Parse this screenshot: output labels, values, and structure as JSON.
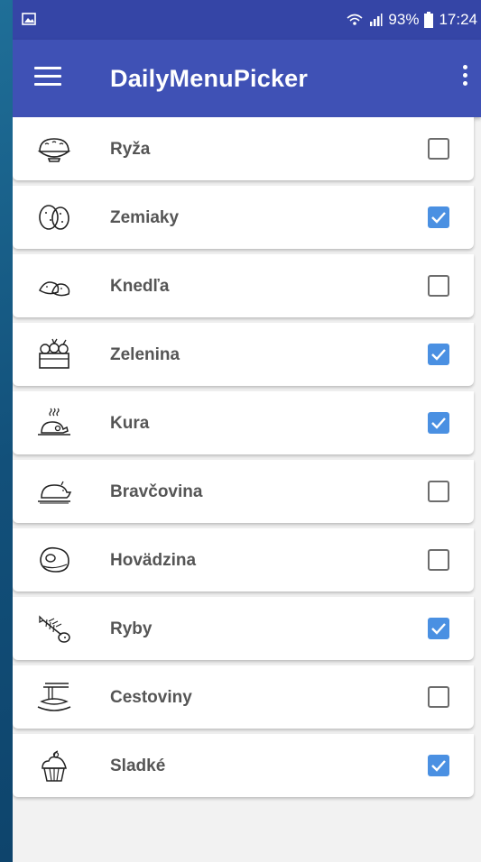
{
  "status_bar": {
    "battery": "93%",
    "time": "17:24",
    "icons": [
      "gallery-icon",
      "wifi-icon",
      "signal-icon",
      "battery-icon"
    ]
  },
  "app_bar": {
    "title": "DailyMenuPicker",
    "icons": [
      "hamburger-menu-icon",
      "more-vertical-icon"
    ]
  },
  "colors": {
    "status_bar": "#3545a6",
    "app_bar": "#3f51b5",
    "checkbox_checked": "#4a90e2",
    "label_text": "#555555"
  },
  "items": [
    {
      "label": "Ryža",
      "icon": "rice-bowl-icon",
      "checked": false
    },
    {
      "label": "Zemiaky",
      "icon": "potatoes-icon",
      "checked": true
    },
    {
      "label": "Knedľa",
      "icon": "dumplings-icon",
      "checked": false
    },
    {
      "label": "Zelenina",
      "icon": "vegetable-crate-icon",
      "checked": true
    },
    {
      "label": "Kura",
      "icon": "roast-chicken-icon",
      "checked": true
    },
    {
      "label": "Bravčovina",
      "icon": "pig-platter-icon",
      "checked": false
    },
    {
      "label": "Hovädzina",
      "icon": "steak-icon",
      "checked": false
    },
    {
      "label": "Ryby",
      "icon": "fish-bone-icon",
      "checked": true
    },
    {
      "label": "Cestoviny",
      "icon": "pasta-plate-icon",
      "checked": false
    },
    {
      "label": "Sladké",
      "icon": "cupcake-icon",
      "checked": true
    }
  ]
}
